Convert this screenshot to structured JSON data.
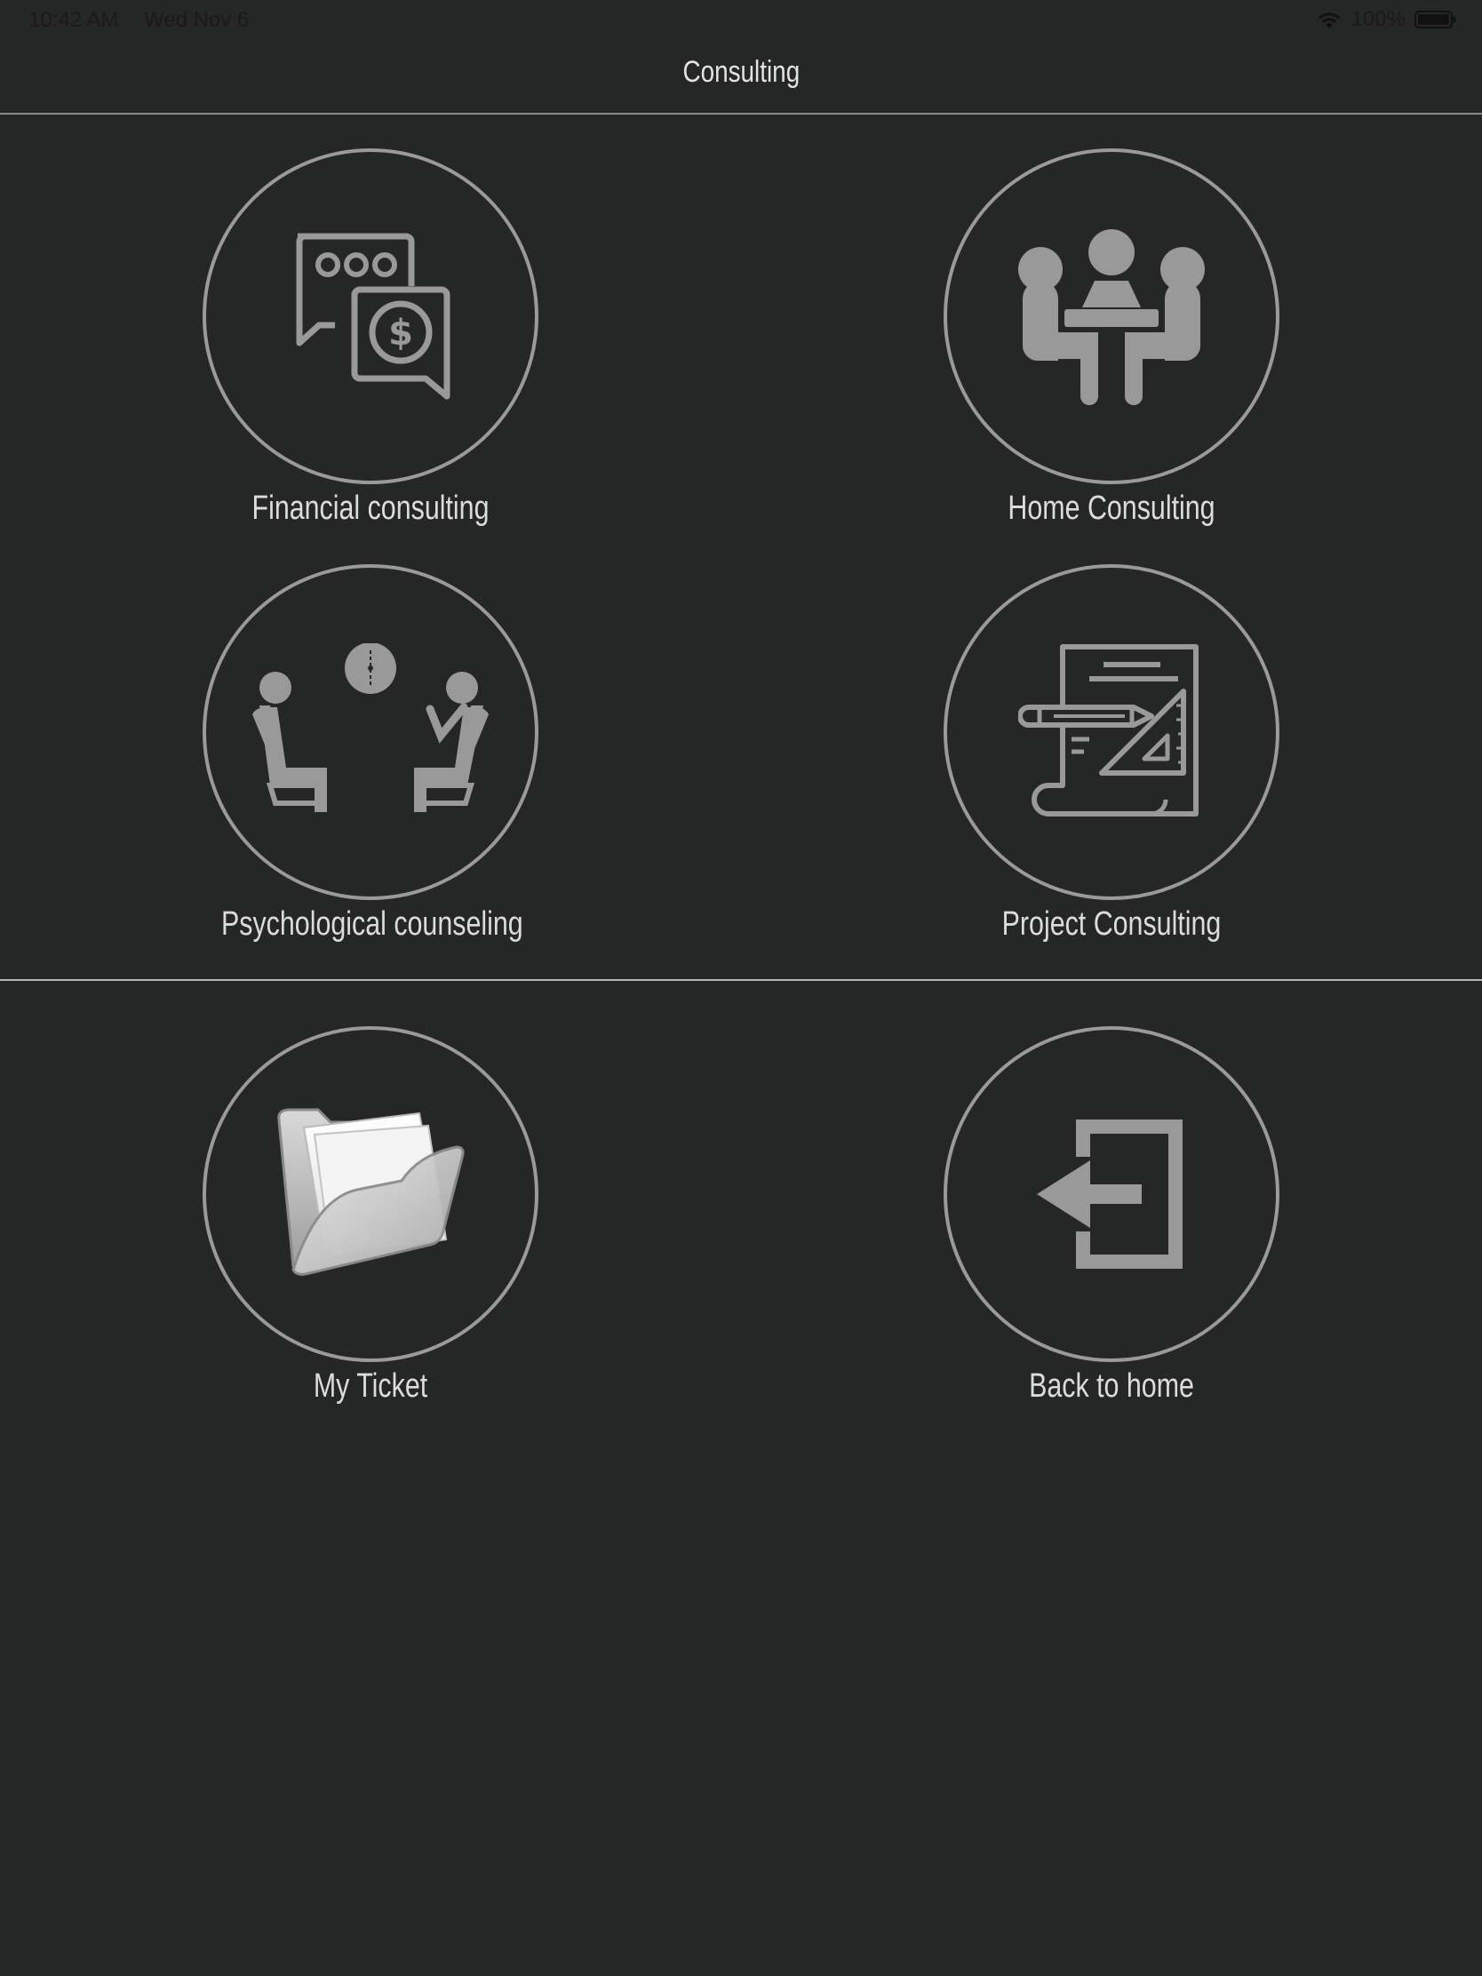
{
  "status_bar": {
    "time": "10:42 AM",
    "date": "Wed Nov 6",
    "battery": "100%"
  },
  "nav": {
    "title": "Consulting"
  },
  "tiles": [
    {
      "label": "Financial consulting",
      "icon": "chat-dollar-icon"
    },
    {
      "label": "Home Consulting",
      "icon": "meeting-table-icon"
    },
    {
      "label": "Psychological counseling",
      "icon": "counseling-session-icon"
    },
    {
      "label": "Project Consulting",
      "icon": "blueprint-icon"
    }
  ],
  "actions": [
    {
      "label": "My Ticket",
      "icon": "folder-icon"
    },
    {
      "label": "Back to home",
      "icon": "exit-arrow-icon"
    }
  ],
  "colors": {
    "background": "#252626",
    "circle_border": "#9a9a9a",
    "icon": "#999999",
    "text": "#dcdcdc"
  }
}
